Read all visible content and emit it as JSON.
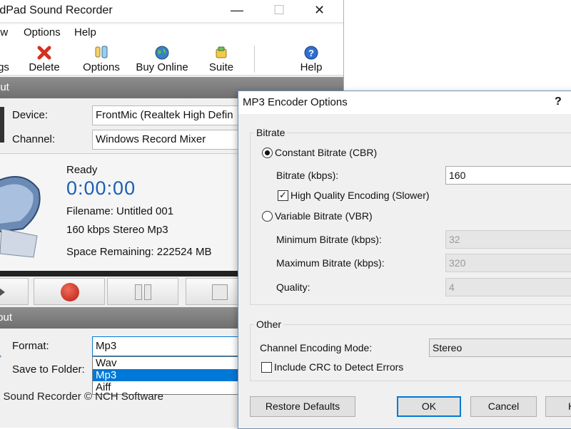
{
  "main_window": {
    "title": "rdPad Sound Recorder",
    "window_controls": {
      "minimize": "—",
      "maximize": "☐",
      "close": "✕"
    },
    "menu": [
      "ew",
      "Options",
      "Help"
    ],
    "toolbar": {
      "items": [
        {
          "label": "gs",
          "icon": "settings-icon"
        },
        {
          "label": "Delete",
          "icon": "delete-icon"
        },
        {
          "label": "Options",
          "icon": "options-icon"
        },
        {
          "label": "Buy Online",
          "icon": "globe-icon"
        },
        {
          "label": "Suite",
          "icon": "suite-icon"
        },
        {
          "label": "Help",
          "icon": "help-icon"
        }
      ]
    },
    "input_section": {
      "header": "put",
      "device_label": "Device:",
      "device_value": "FrontMic (Realtek High Defin",
      "channel_label": "Channel:",
      "channel_value": "Windows Record Mixer"
    },
    "status": {
      "state": "Ready",
      "time": "0:00:00",
      "filename": "Filename: Untitled 001",
      "format_info": "160 kbps Stereo Mp3",
      "space": "Space Remaining: 222524 MB"
    },
    "output_section": {
      "header": "tput",
      "format_label": "Format:",
      "format_value": "Mp3",
      "format_options": [
        "Wav",
        "Mp3",
        "Aiff"
      ],
      "selected_option": "Mp3",
      "folder_label": "Save to Folder:"
    },
    "footer": "d Sound Recorder  © NCH Software"
  },
  "dialog": {
    "title": "MP3 Encoder Options",
    "help": "?",
    "bitrate_group": "Bitrate",
    "cbr_label": "Constant Bitrate (CBR)",
    "bitrate_label": "Bitrate (kbps):",
    "bitrate_value": "160",
    "hq_label": "High Quality Encoding (Slower)",
    "hq_checked": "✓",
    "vbr_label": "Variable Bitrate (VBR)",
    "min_label": "Minimum Bitrate (kbps):",
    "min_value": "32",
    "max_label": "Maximum Bitrate (kbps):",
    "max_value": "320",
    "quality_label": "Quality:",
    "quality_value": "4",
    "other_group": "Other",
    "channel_mode_label": "Channel Encoding Mode:",
    "channel_mode_value": "Stereo",
    "crc_label": "Include CRC to Detect Errors",
    "buttons": {
      "restore": "Restore Defaults",
      "ok": "OK",
      "cancel": "Cancel",
      "help": "H"
    }
  },
  "colors": {
    "accent": "#0078d7",
    "time": "#1a5fb4",
    "header": "#7a7a7a",
    "record": "#cc2a1e"
  }
}
